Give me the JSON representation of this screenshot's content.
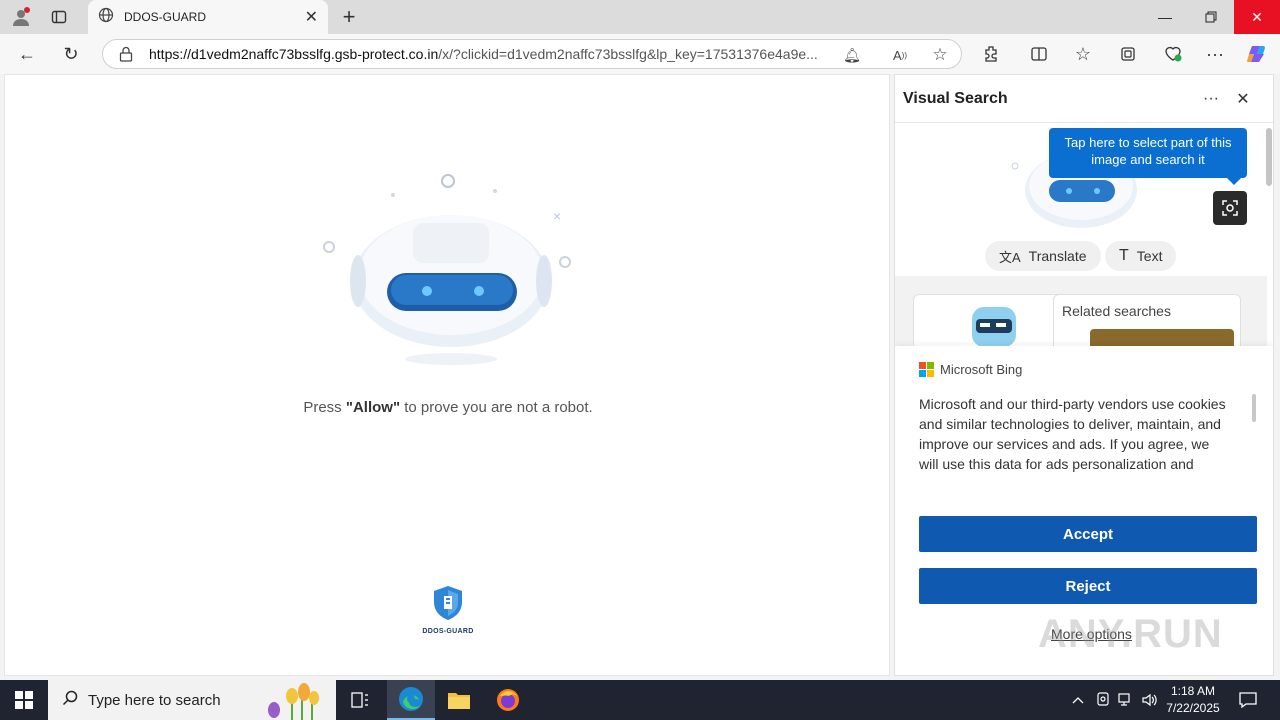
{
  "browser": {
    "tab_title": "DDOS-GUARD",
    "url_host": "https://d1vedm2naffc73bsslfg.gsb-protect.co.in",
    "url_rest": "/x/?clickid=d1vedm2naffc73bsslfg&lp_key=17531376e4a9e..."
  },
  "page": {
    "press_before": "Press ",
    "press_bold": "\"Allow\"",
    "press_after": " to prove you are not a robot.",
    "logo_text": "DDOS-GUARD"
  },
  "visual_search": {
    "title": "Visual Search",
    "tooltip": "Tap here to select part of this image and search it",
    "translate_label": "Translate",
    "text_label": "Text",
    "related_searches": "Related searches"
  },
  "consent": {
    "brand": "Microsoft Bing",
    "text": "Microsoft and our third-party vendors use cookies and similar technologies to deliver, maintain, and improve our services and ads. If you agree, we will use this data for ads personalization and",
    "accept": "Accept",
    "reject": "Reject",
    "more": "More options"
  },
  "watermark": "ANY.RUN",
  "taskbar": {
    "search_placeholder": "Type here to search",
    "time": "1:18 AM",
    "date": "7/22/2025"
  },
  "colors": {
    "accent_blue": "#0f5ab0",
    "tooltip_blue": "#0a6fd1",
    "close_red": "#e81123"
  }
}
